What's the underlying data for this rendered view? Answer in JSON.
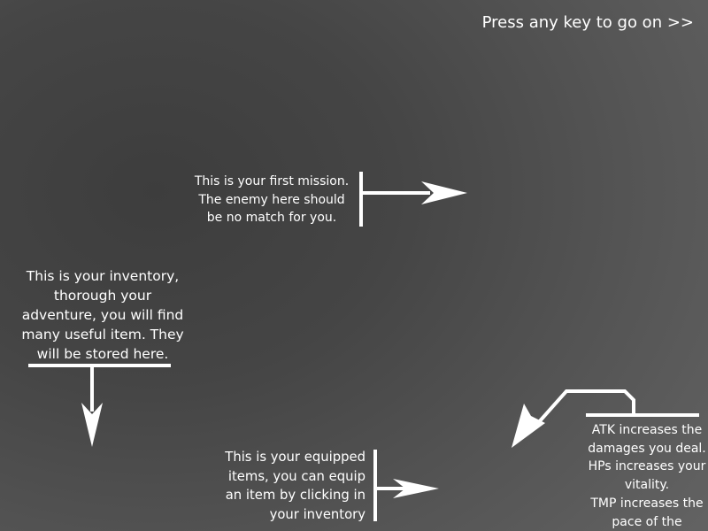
{
  "tutorial": {
    "continue_prompt": "Press any key to go on >>",
    "tips": {
      "mission": "This is your first mission.\nThe enemy here should\nbe no match for you.",
      "inventory": "This is your inventory,\nthorough your\nadventure, you will find\nmany useful item. They\nwill be stored here.",
      "equipped": "This is your equipped\nitems, you can equip\nan item by clicking in\nyour inventory",
      "stats": "ATK increases the\ndamages you deal.\nHPs increases your\nvitality.\nTMP increases the\npace of the battles."
    }
  },
  "colors": {
    "background_dark": "#3d3d3d",
    "background_light": "#626262",
    "text": "#ffffff",
    "arrow": "#ffffff"
  }
}
